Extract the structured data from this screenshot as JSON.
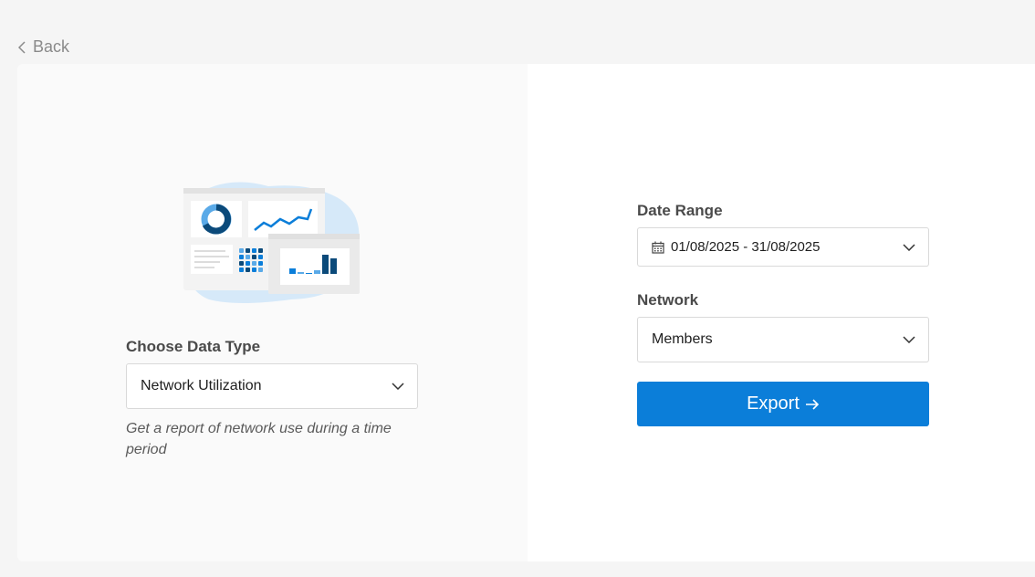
{
  "nav": {
    "back_label": "Back"
  },
  "left": {
    "data_type_label": "Choose Data Type",
    "data_type_value": "Network Utilization",
    "description": "Get a report of network use during a time period"
  },
  "right": {
    "date_range_label": "Date Range",
    "date_range_value": "01/08/2025 - 31/08/2025",
    "network_label": "Network",
    "network_value": "Members",
    "export_label": "Export"
  },
  "colors": {
    "accent": "#0b7ed9",
    "background": "#f5f5f5",
    "illustration_blob": "#d6e9f9",
    "illustration_dark": "#0b4a7a"
  },
  "icons": [
    "chevron-left-icon",
    "chevron-down-icon",
    "calendar-icon",
    "arrow-right-icon"
  ]
}
